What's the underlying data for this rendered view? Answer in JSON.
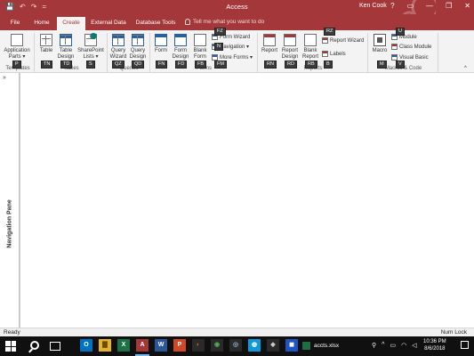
{
  "window": {
    "title": "Access",
    "user": "Ken Cook",
    "help_glyph": "?",
    "minimize_glyph": "—",
    "restore_glyph": "❐",
    "close_glyph": "✕"
  },
  "qat": {
    "save": "💾",
    "undo": "↶",
    "redo": "↷",
    "more": "="
  },
  "tabs": [
    "File",
    "Home",
    "Create",
    "External Data",
    "Database Tools"
  ],
  "active_tab": "Create",
  "tell_me": "Tell me what you want to do",
  "ribbon": {
    "application_parts": "Application Parts ▾",
    "table": "Table",
    "table_design": "Table Design",
    "sharepoint_lists": "SharePoint Lists ▾",
    "query_wizard": "Query Wizard",
    "query_design": "Query Design",
    "form": "Form",
    "form_design": "Form Design",
    "blank_form": "Blank Form",
    "form_wizard": "Form Wizard",
    "navigation": "Navigation ▾",
    "more_forms": "More Forms ▾",
    "report": "Report",
    "report_design": "Report Design",
    "blank_report": "Blank Report",
    "report_wizard": "Report Wizard",
    "labels": "Labels",
    "macro": "Macro",
    "module": "Module",
    "class_module": "Class Module",
    "visual_basic": "Visual Basic"
  },
  "groups": {
    "templates": "Templates",
    "tables": "Tables",
    "queries": "Queries",
    "forms": "Forms",
    "reports": "Reports",
    "macros_code": "Macros & Code"
  },
  "keytips": {
    "templates": "P",
    "table": "TN",
    "table_design": "TD",
    "sharepoint": "S",
    "query_wizard": "QZ",
    "query_design": "QD",
    "form": "FN",
    "form_design": "FD",
    "blank_form": "FB",
    "form_wizard": "FZ",
    "navigation": "N",
    "more_forms": "FM",
    "report": "RN",
    "report_design": "RD",
    "blank_report": "RB",
    "report_wizard": "RZ",
    "labels": "B",
    "macro": "M",
    "module": "U",
    "visual_basic": "V"
  },
  "nav_pane": {
    "label": "Navigation Pane",
    "toggle": "»"
  },
  "status": {
    "left": "Ready",
    "right": "Num Lock"
  },
  "taskbar": {
    "file_label": "accts.xlsx",
    "time": "10:36 PM",
    "date": "8/6/2018",
    "app_letters": [
      "O",
      "▇",
      "X",
      "A",
      "W",
      "P",
      "◐",
      "◉",
      "◎",
      "◍",
      "◆",
      "◼"
    ],
    "tray_icons": [
      "⚲",
      "^",
      "▭",
      "◠",
      "◁"
    ]
  }
}
